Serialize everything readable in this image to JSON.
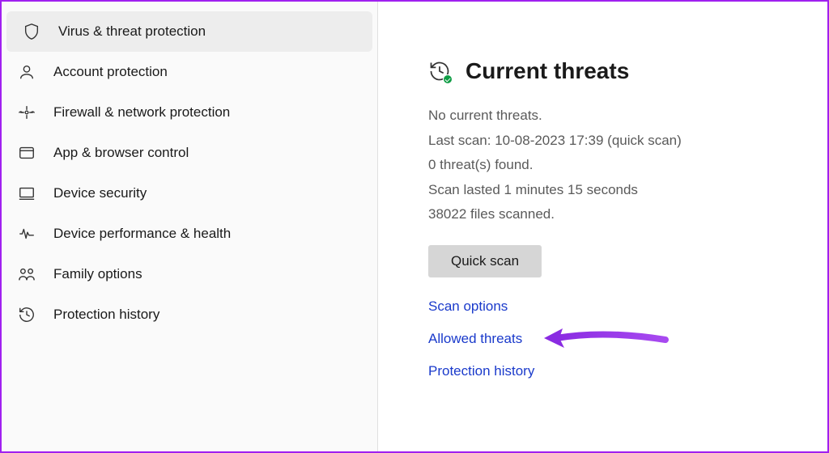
{
  "sidebar": {
    "items": [
      {
        "label": "Virus & threat protection",
        "icon": "shield-icon",
        "active": true
      },
      {
        "label": "Account protection",
        "icon": "account-icon",
        "active": false
      },
      {
        "label": "Firewall & network protection",
        "icon": "firewall-icon",
        "active": false
      },
      {
        "label": "App & browser control",
        "icon": "app-browser-icon",
        "active": false
      },
      {
        "label": "Device security",
        "icon": "device-security-icon",
        "active": false
      },
      {
        "label": "Device performance & health",
        "icon": "performance-icon",
        "active": false
      },
      {
        "label": "Family options",
        "icon": "family-icon",
        "active": false
      },
      {
        "label": "Protection history",
        "icon": "history-icon",
        "active": false
      }
    ]
  },
  "main": {
    "section_title": "Current threats",
    "status": {
      "no_threats": "No current threats.",
      "last_scan": "Last scan: 10-08-2023 17:39 (quick scan)",
      "threats_found": "0 threat(s) found.",
      "duration": "Scan lasted 1 minutes 15 seconds",
      "files_scanned": "38022 files scanned."
    },
    "quick_scan_label": "Quick scan",
    "links": {
      "scan_options": "Scan options",
      "allowed_threats": "Allowed threats",
      "protection_history": "Protection history"
    }
  },
  "annotation": {
    "target": "scan-options-link",
    "color": "#8a2be2"
  }
}
